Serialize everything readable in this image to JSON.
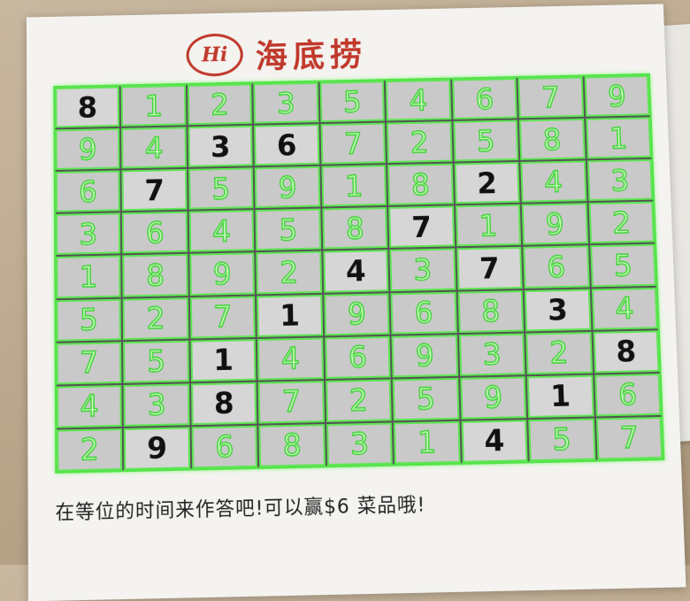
{
  "brand": {
    "logo_text": "Hi",
    "name": "海底捞"
  },
  "sudoku": {
    "rows": [
      [
        8,
        1,
        2,
        3,
        5,
        4,
        6,
        7,
        9
      ],
      [
        9,
        4,
        3,
        6,
        7,
        2,
        5,
        8,
        1
      ],
      [
        6,
        7,
        5,
        9,
        1,
        8,
        2,
        4,
        3
      ],
      [
        3,
        6,
        4,
        5,
        8,
        7,
        1,
        9,
        2
      ],
      [
        1,
        8,
        9,
        2,
        4,
        3,
        7,
        6,
        5
      ],
      [
        5,
        2,
        7,
        1,
        9,
        6,
        8,
        3,
        4
      ],
      [
        7,
        5,
        1,
        4,
        6,
        9,
        3,
        2,
        8
      ],
      [
        4,
        3,
        8,
        7,
        2,
        5,
        9,
        1,
        6
      ],
      [
        2,
        9,
        6,
        8,
        3,
        1,
        4,
        5,
        7
      ]
    ],
    "given": [
      [
        1,
        0,
        0,
        0,
        0,
        0,
        0,
        0,
        0
      ],
      [
        0,
        0,
        1,
        1,
        0,
        0,
        0,
        0,
        0
      ],
      [
        0,
        1,
        0,
        0,
        0,
        0,
        1,
        0,
        0
      ],
      [
        0,
        0,
        0,
        0,
        0,
        1,
        0,
        0,
        0
      ],
      [
        0,
        0,
        0,
        0,
        1,
        0,
        1,
        0,
        0
      ],
      [
        0,
        0,
        0,
        1,
        0,
        0,
        0,
        1,
        0
      ],
      [
        0,
        0,
        1,
        0,
        0,
        0,
        0,
        0,
        1
      ],
      [
        0,
        0,
        1,
        0,
        0,
        0,
        0,
        1,
        0
      ],
      [
        0,
        1,
        0,
        0,
        0,
        0,
        1,
        0,
        0
      ]
    ],
    "colors": {
      "grid_line": "#5ee653",
      "given_digit": "#111111",
      "solved_digit_fill": "#c9f7bd",
      "solved_digit_stroke": "#3fd437"
    }
  },
  "footer": {
    "text": "在等位的时间来作答吧!可以赢$6 菜品哦!"
  }
}
